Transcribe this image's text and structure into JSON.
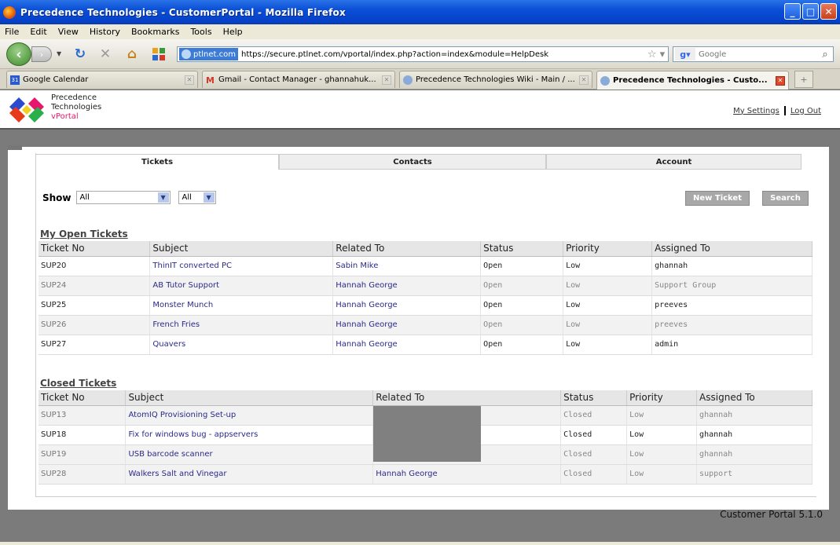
{
  "window": {
    "title": "Precedence Technologies - CustomerPortal - Mozilla Firefox"
  },
  "menu": [
    "File",
    "Edit",
    "View",
    "History",
    "Bookmarks",
    "Tools",
    "Help"
  ],
  "nav": {
    "site_badge": "ptlnet.com",
    "url": "https://secure.ptlnet.com/vportal/index.php?action=index&module=HelpDesk",
    "search_placeholder": "Google"
  },
  "browser_tabs": [
    {
      "label": "Google Calendar"
    },
    {
      "label": "Gmail - Contact Manager - ghannahuk..."
    },
    {
      "label": "Precedence Technologies Wiki - Main / ..."
    },
    {
      "label": "Precedence Technologies - Custo..."
    }
  ],
  "brand": {
    "line1": "Precedence",
    "line2": "Technologies",
    "line3": "vPortal"
  },
  "toplinks": {
    "settings": "My Settings",
    "logout": "Log Out"
  },
  "portal_tabs": [
    "Tickets",
    "Contacts",
    "Account"
  ],
  "filters": {
    "show_label": "Show",
    "filter1": "All",
    "filter2": "All"
  },
  "buttons": {
    "new_ticket": "New Ticket",
    "search": "Search"
  },
  "open_tickets": {
    "title": "My Open Tickets",
    "columns": [
      "Ticket No",
      "Subject",
      "Related To",
      "Status",
      "Priority",
      "Assigned To"
    ],
    "rows": [
      [
        "SUP20",
        "ThinIT converted PC",
        "Sabin Mike",
        "Open",
        "Low",
        "ghannah"
      ],
      [
        "SUP24",
        "AB Tutor Support",
        "Hannah George",
        "Open",
        "Low",
        "Support Group"
      ],
      [
        "SUP25",
        "Monster Munch",
        "Hannah George",
        "Open",
        "Low",
        "preeves"
      ],
      [
        "SUP26",
        "French Fries",
        "Hannah George",
        "Open",
        "Low",
        "preeves"
      ],
      [
        "SUP27",
        "Quavers",
        "Hannah George",
        "Open",
        "Low",
        "admin"
      ]
    ]
  },
  "closed_tickets": {
    "title": "Closed Tickets",
    "columns": [
      "Ticket No",
      "Subject",
      "Related To",
      "Status",
      "Priority",
      "Assigned To"
    ],
    "rows": [
      [
        "SUP13",
        "AtomIQ Provisioning Set-up",
        "",
        "Closed",
        "Low",
        "ghannah"
      ],
      [
        "SUP18",
        "Fix for windows bug - appservers",
        "",
        "Closed",
        "Low",
        "ghannah"
      ],
      [
        "SUP19",
        "USB barcode scanner",
        "",
        "Closed",
        "Low",
        "ghannah"
      ],
      [
        "SUP28",
        "Walkers Salt and Vinegar",
        "Hannah George",
        "Closed",
        "Low",
        "support"
      ]
    ]
  },
  "footer": "Customer Portal 5.1.0"
}
